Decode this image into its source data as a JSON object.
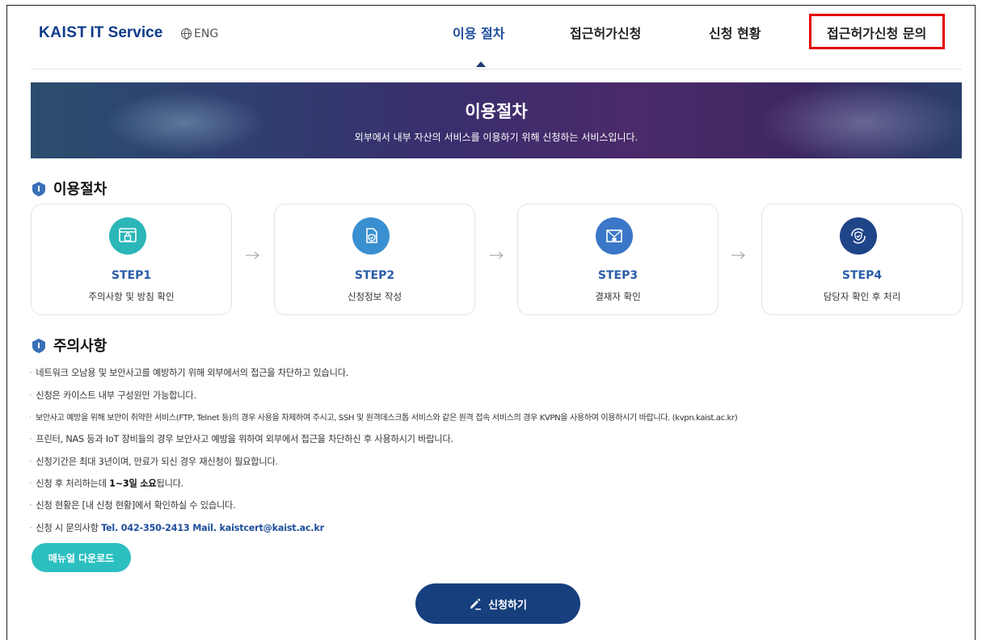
{
  "header": {
    "logo_kaist": "KAIST",
    "logo_service": "IT Service",
    "lang_label": "ENG",
    "nav": [
      {
        "label": "이용 절차",
        "active": true
      },
      {
        "label": "접근허가신청",
        "active": false
      },
      {
        "label": "신청 현황",
        "active": false
      },
      {
        "label": "접근허가신청 문의",
        "active": false
      }
    ]
  },
  "banner": {
    "title": "이용절차",
    "subtitle": "외부에서 내부 자산의 서비스를 이용하기 위해 신청하는 서비스입니다."
  },
  "procedure": {
    "title": "이용절차",
    "steps": [
      {
        "label": "STEP1",
        "desc": "주의사항 및 방침 확인",
        "icon": "browser-lock-icon",
        "color": "#2bb6b8"
      },
      {
        "label": "STEP2",
        "desc": "신청정보 작성",
        "icon": "document-check-icon",
        "color": "#3a8fd0"
      },
      {
        "label": "STEP3",
        "desc": "결재자 확인",
        "icon": "envelope-lock-icon",
        "color": "#3b77c8"
      },
      {
        "label": "STEP4",
        "desc": "담당자 확인 후 처리",
        "icon": "shield-refresh-icon",
        "color": "#1f4488"
      }
    ]
  },
  "notices": {
    "title": "주의사항",
    "items": [
      "네트워크 오남용 및 보안사고를 예방하기 위해 외부에서의 접근을 차단하고 있습니다.",
      "신청은 카이스트 내부 구성원만 가능합니다.",
      "보안사고 예방을 위해 보안이 취약한 서비스(FTP, Telnet 등)의 경우 사용을 자제하여 주시고, SSH 및 원격데스크톱 서비스와 같은 원격 접속 서비스의 경우 KVPN을 사용하여 이용하시기 바랍니다. (kvpn.kaist.ac.kr)",
      "프린터, NAS 등과 IoT 장비들의 경우 보안사고 예방을 위하여 외부에서 접근을 차단하신 후 사용하시기 바랍니다.",
      "신청기간은 최대 3년이며, 만료가 되신 경우 재신청이 필요합니다."
    ],
    "processing_prefix": "신청 후 처리하는데 ",
    "processing_bold": "1~3일 소요",
    "processing_suffix": "됩니다.",
    "status_note": "신청 현황은 [내 신청 현황]에서 확인하실 수 있습니다.",
    "contact_prefix": "신청 시 문의사항 ",
    "contact": "Tel. 042-350-2413 Mail. kaistcert@kaist.ac.kr"
  },
  "buttons": {
    "manual": "매뉴얼 다운로드",
    "apply": "신청하기"
  },
  "colors": {
    "brand": "#0d3b8a",
    "highlight": "#e60000",
    "manual_button": "#2cbfc0",
    "apply_button": "#173f7e"
  }
}
